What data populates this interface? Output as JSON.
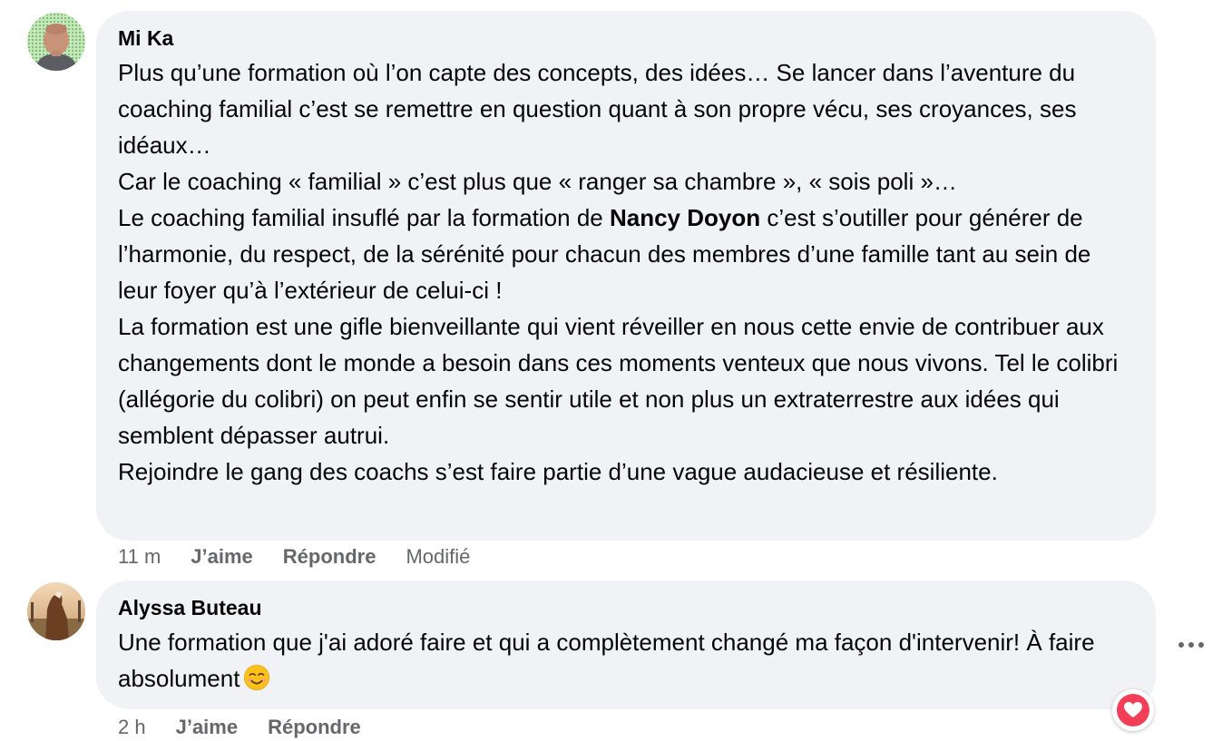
{
  "comments": [
    {
      "author": "Mi Ka",
      "paragraphs": [
        "Plus qu’une formation où l’on capte des concepts, des idées… Se lancer dans l’aventure du coaching familial c’est se remettre en question quant à son propre vécu, ses croyances, ses idéaux…",
        "Car le coaching « familial » c’est plus que « ranger sa chambre », « sois poli »…"
      ],
      "mention_prefix": "Le coaching familial insuflé par la formation de ",
      "mention": "Nancy Doyon",
      "mention_suffix": " c’est s’outiller pour générer de l’harmonie, du respect, de la sérénité pour chacun des membres d’une famille tant au sein de leur foyer qu’à l’extérieur de celui-ci !",
      "paragraphs_after": [
        "La formation est une gifle bienveillante qui vient réveiller en nous cette envie de contribuer aux changements dont le monde a besoin dans ces moments venteux que nous vivons. Tel le colibri (allégorie du colibri) on peut enfin se sentir utile et non plus un extraterrestre aux idées qui semblent dépasser autrui.",
        "Rejoindre le gang des coachs s’est faire partie d’une vague audacieuse et résiliente."
      ],
      "time": "11 m",
      "like_label": "J’aime",
      "reply_label": "Répondre",
      "edited_label": "Modifié"
    },
    {
      "author": "Alyssa Buteau",
      "text": "Une formation que j'ai adoré faire et qui a complètement changé ma façon d'intervenir! À faire absolument",
      "emoji": "smiling-face-icon",
      "time": "2 h",
      "like_label": "J’aime",
      "reply_label": "Répondre",
      "reaction": "love-heart-icon"
    }
  ],
  "colors": {
    "bubble": "#f0f2f5",
    "meta_text": "#65676b",
    "heart": "#f33e58"
  }
}
